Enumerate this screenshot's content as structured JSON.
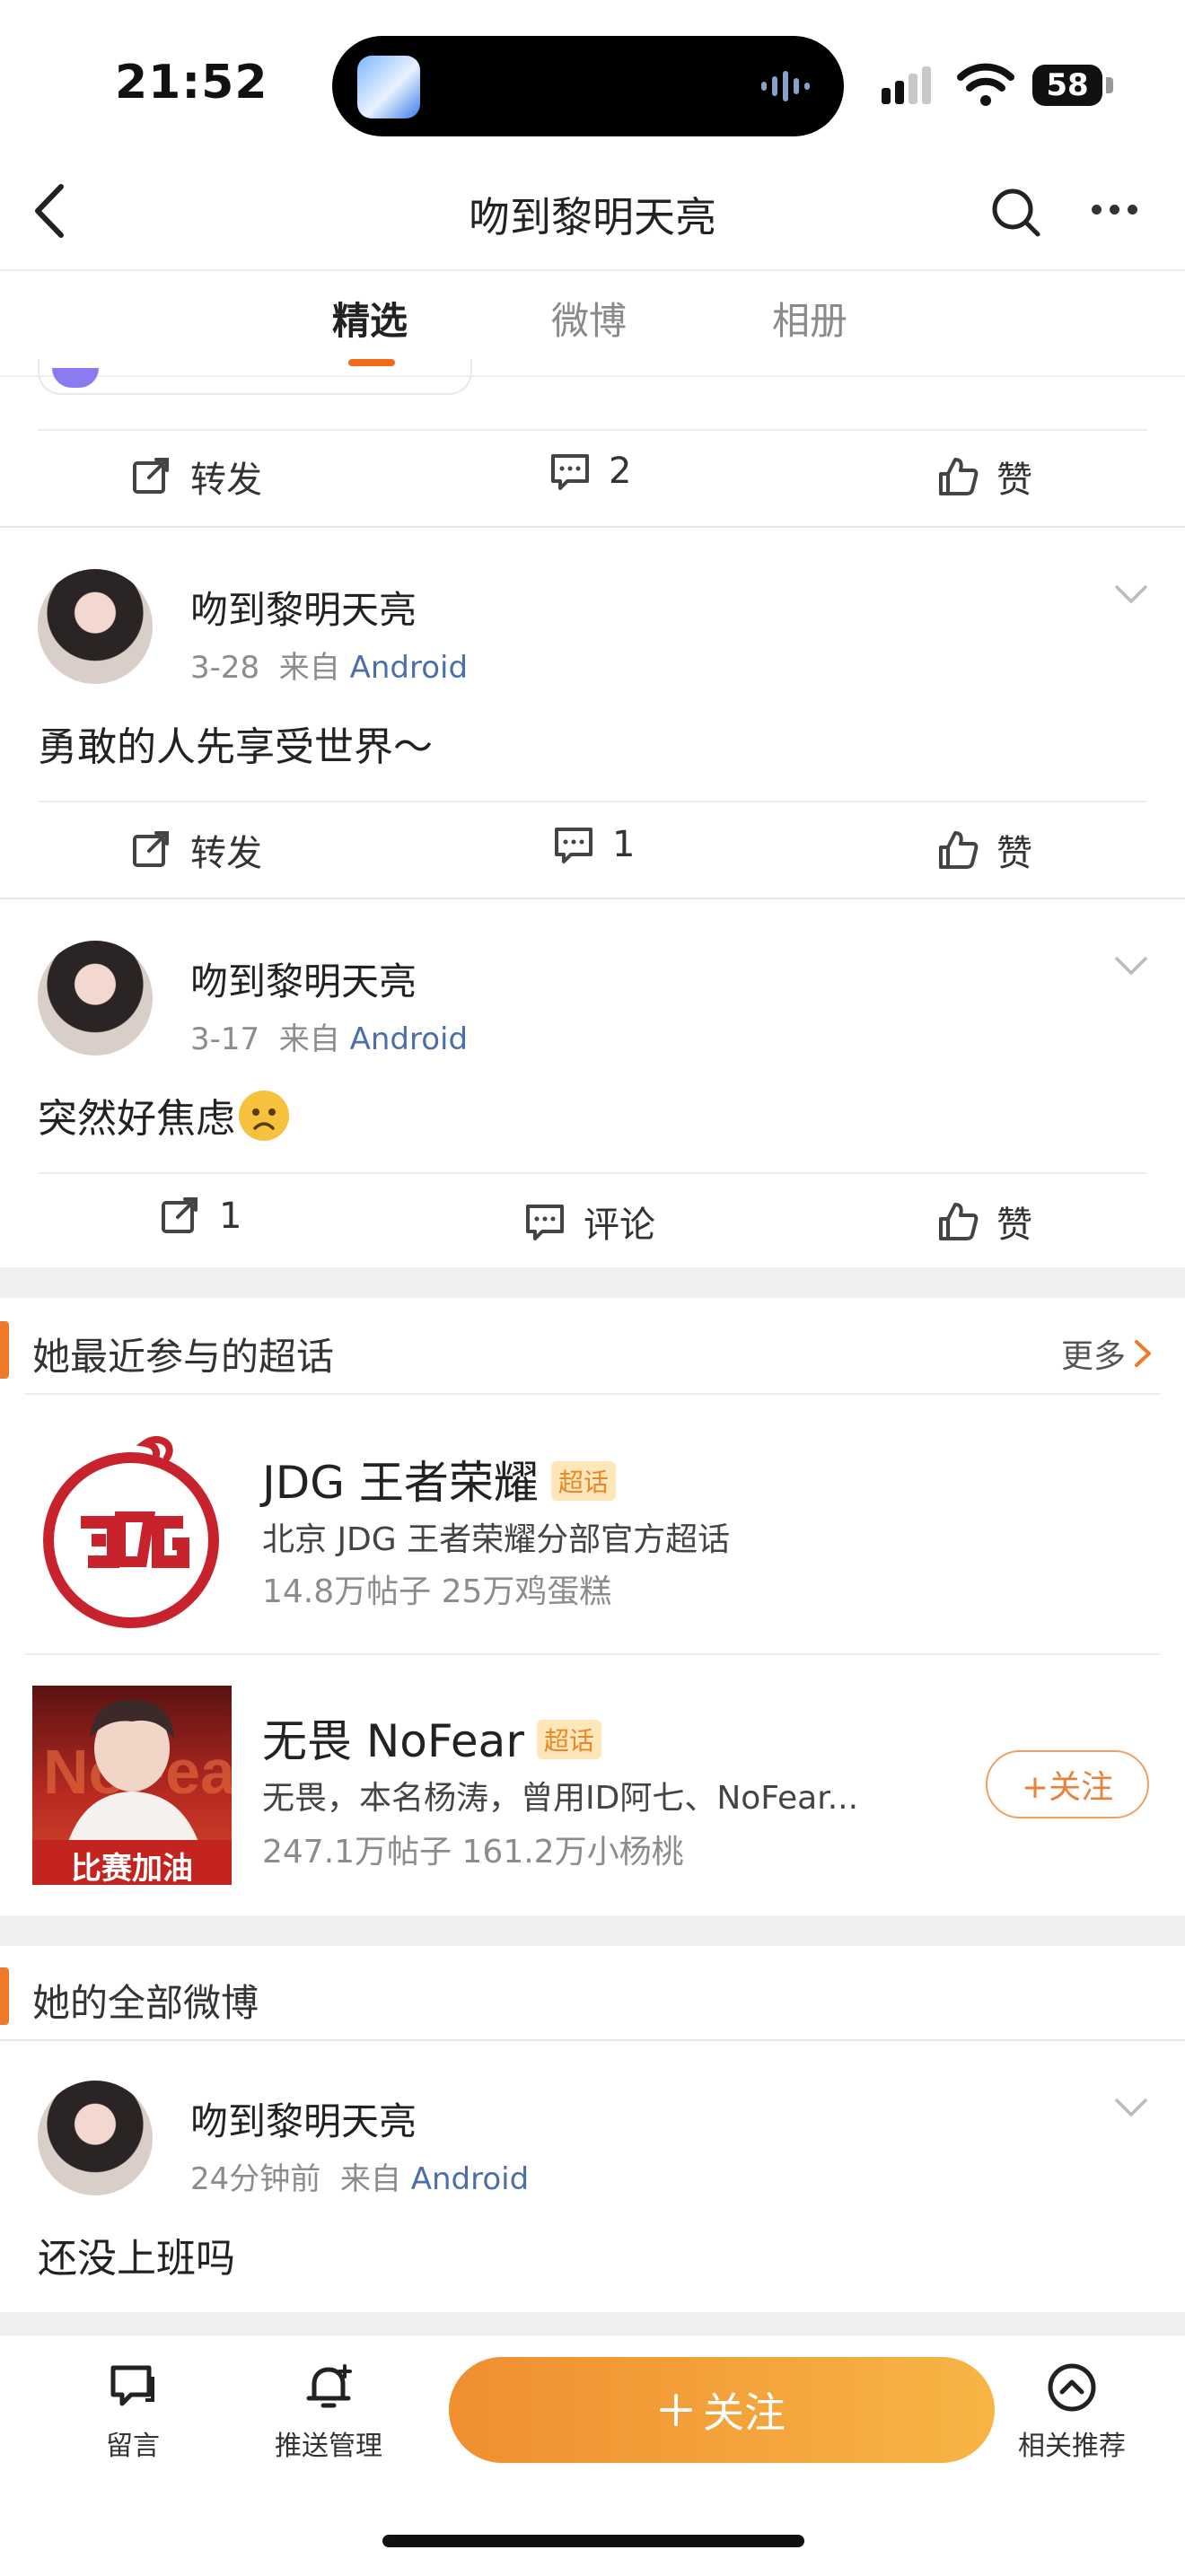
{
  "status_bar": {
    "time": "21:52",
    "battery": "58"
  },
  "nav": {
    "title": "吻到黎明天亮"
  },
  "tabs": [
    {
      "label": "精选",
      "active": true
    },
    {
      "label": "微博",
      "active": false
    },
    {
      "label": "相册",
      "active": false
    }
  ],
  "posts": [
    {
      "actions": {
        "repost": "转发",
        "comment": "2",
        "like": "赞"
      }
    },
    {
      "username": "吻到黎明天亮",
      "date": "3-28",
      "from_label": "来自",
      "source": "Android",
      "text": "勇敢的人先享受世界～",
      "actions": {
        "repost": "转发",
        "comment": "1",
        "like": "赞"
      }
    },
    {
      "username": "吻到黎明天亮",
      "date": "3-17",
      "from_label": "来自",
      "source": "Android",
      "text": "突然好焦虑",
      "emoji": "worried-face-emoji",
      "actions": {
        "repost": "1",
        "comment": "评论",
        "like": "赞"
      }
    }
  ],
  "supertopics": {
    "title": "她最近参与的超话",
    "more": "更多",
    "items": [
      {
        "name": "JDG 王者荣耀",
        "badge": "超话",
        "desc": "北京 JDG 王者荣耀分部官方超话",
        "stats": "14.8万帖子 25万鸡蛋糕"
      },
      {
        "name": "无畏 NoFear",
        "badge": "超话",
        "desc": "无畏，本名杨涛，曾用ID阿七、NoFear...",
        "stats": "247.1万帖子 161.2万小杨桃",
        "follow": "+关注",
        "image_caption": "比赛加油"
      }
    ]
  },
  "all_posts": {
    "title": "她的全部微博",
    "post": {
      "username": "吻到黎明天亮",
      "date": "24分钟前",
      "from_label": "来自",
      "source": "Android",
      "text": "还没上班吗"
    }
  },
  "bottom_bar": {
    "message": "留言",
    "push": "推送管理",
    "follow": "关注",
    "related": "相关推荐"
  },
  "colors": {
    "accent": "#f26b1d",
    "link": "#4c6fa8",
    "follow_gradient_start": "#f08e30",
    "follow_gradient_end": "#f7b545"
  }
}
